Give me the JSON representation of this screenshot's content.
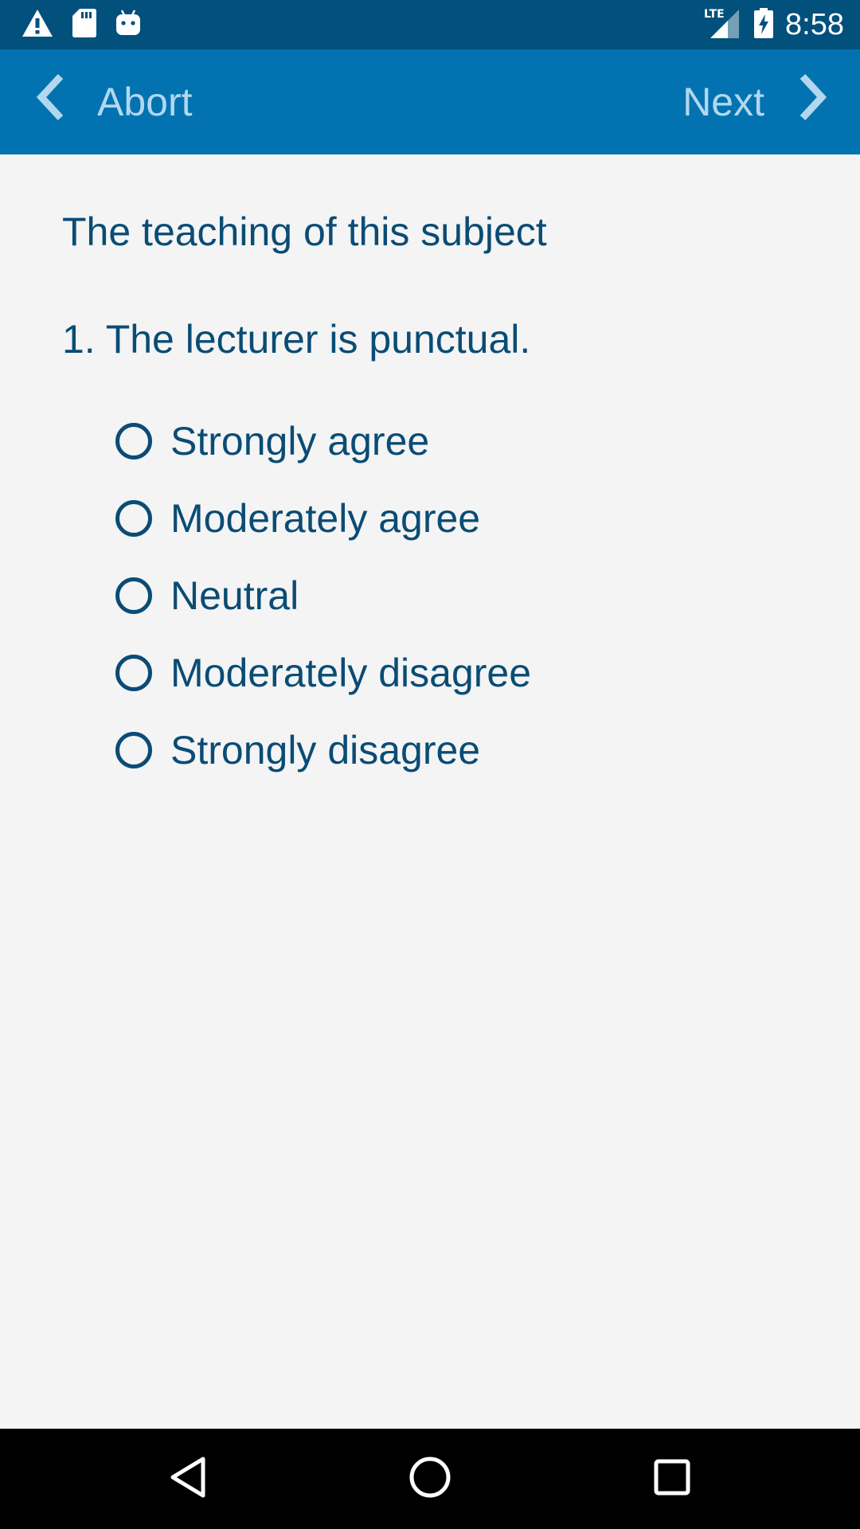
{
  "status_bar": {
    "time": "8:58",
    "network_label": "LTE",
    "icons": [
      "warning-icon",
      "sd-card-icon",
      "android-icon",
      "signal-icon",
      "battery-charging-icon"
    ]
  },
  "app_bar": {
    "back_label": "Abort",
    "next_label": "Next"
  },
  "survey": {
    "section_title": "The teaching of this subject",
    "question": "1. The lecturer is punctual.",
    "options": [
      {
        "label": "Strongly agree",
        "selected": false
      },
      {
        "label": "Moderately agree",
        "selected": false
      },
      {
        "label": "Neutral",
        "selected": false
      },
      {
        "label": "Moderately disagree",
        "selected": false
      },
      {
        "label": "Strongly disagree",
        "selected": false
      }
    ]
  },
  "system_nav": {
    "icons": [
      "back-triangle-icon",
      "home-circle-icon",
      "recents-square-icon"
    ]
  },
  "colors": {
    "status_bar": "#02507c",
    "app_bar": "#0273b0",
    "app_bar_text": "#b3d7ee",
    "content_text": "#0a4c74",
    "background": "#f4f4f5"
  }
}
